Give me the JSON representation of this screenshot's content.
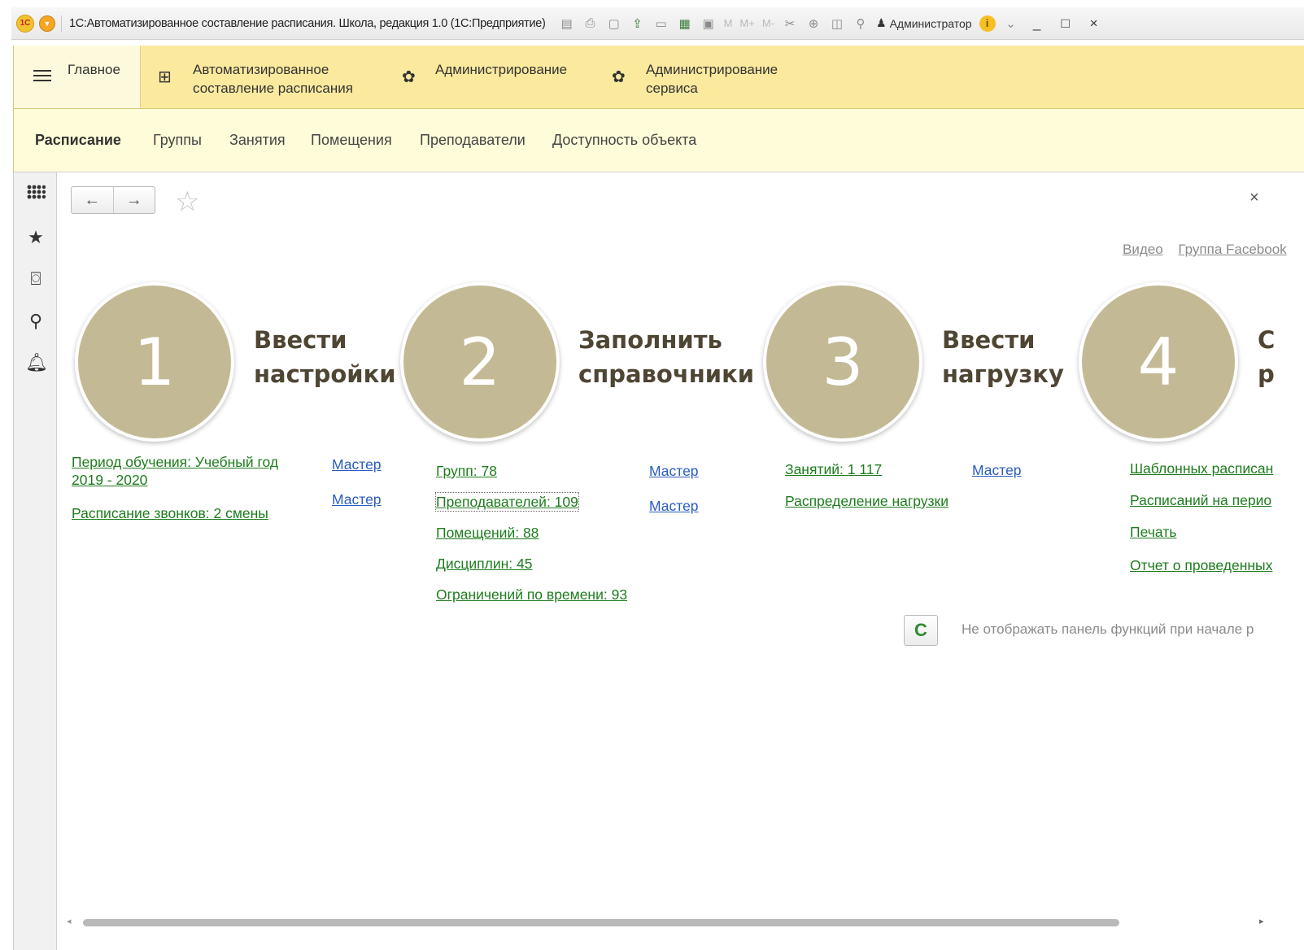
{
  "window": {
    "logo_text": "1С",
    "title": "1С:Автоматизированное составление расписания. Школа, редакция 1.0  (1С:Предприятие)",
    "toolbar_m": [
      "M",
      "M+",
      "M-"
    ],
    "user": "Администратор",
    "info_symbol": "i",
    "controls": {
      "minimize": "_",
      "maximize": "□",
      "close": "×"
    }
  },
  "sections": {
    "items": [
      {
        "label_1": "Главное",
        "label_2": ""
      },
      {
        "label_1": "Автоматизированное",
        "label_2": "составление расписания"
      },
      {
        "label_1": "Администрирование",
        "label_2": ""
      },
      {
        "label_1": "Администрирование",
        "label_2": "сервиса"
      }
    ]
  },
  "subnav": {
    "items": [
      "Расписание",
      "Группы",
      "Занятия",
      "Помещения",
      "Преподаватели",
      "Доступность объекта"
    ],
    "active": "Расписание"
  },
  "toolbar": {
    "back": "←",
    "forward": "→",
    "star": "☆",
    "close": "×"
  },
  "links": {
    "video": "Видео",
    "facebook": "Группа Facebook"
  },
  "steps": [
    {
      "number": "1",
      "title_1": "Ввести",
      "title_2": "настройки",
      "items": [
        {
          "text_1": "Период обучения: Учебный год",
          "text_2": "2019 - 2020",
          "master": "Мастер"
        },
        {
          "text_1": "Расписание звонков: 2 смены",
          "master": "Мастер"
        }
      ]
    },
    {
      "number": "2",
      "title_1": "Заполнить",
      "title_2": "справочники",
      "items": [
        {
          "text": "Групп: 78",
          "master": "Мастер"
        },
        {
          "text": "Преподавателей: 109",
          "master": "Мастер"
        },
        {
          "text": "Помещений: 88"
        },
        {
          "text": "Дисциплин: 45"
        },
        {
          "text": "Ограничений по времени: 93"
        }
      ]
    },
    {
      "number": "3",
      "title_1": "Ввести",
      "title_2": "нагрузку",
      "items": [
        {
          "text": "Занятий: 1 117",
          "master": "Мастер"
        },
        {
          "text": "Распределение нагрузки"
        }
      ]
    },
    {
      "number": "4",
      "title_1": "С",
      "title_2": "р",
      "items": [
        {
          "text": "Шаблонных расписан"
        },
        {
          "text": "Расписаний на перио"
        },
        {
          "text": "Печать"
        },
        {
          "text": "Отчет о проведенных"
        }
      ]
    }
  ],
  "footer": {
    "refresh_icon": "C",
    "hint": "Не отображать панель функций при начале р"
  },
  "icons": {
    "left_panel": [
      "apps-grid-icon",
      "favorites-star-icon",
      "history-icon",
      "search-icon",
      "notifications-bell-icon"
    ]
  },
  "colors": {
    "section_bar": "#fbe99e",
    "subnav": "#fffcd9",
    "circle": "#c3ba95",
    "green_link": "#1e7c1e",
    "blue_link": "#2a5bbf"
  }
}
